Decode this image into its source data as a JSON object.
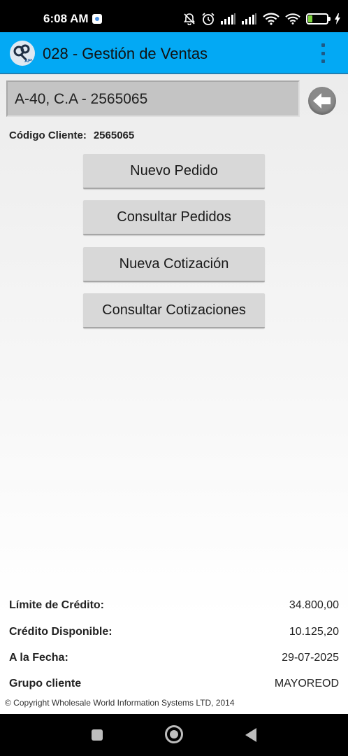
{
  "status_bar": {
    "time": "6:08 AM",
    "battery_level": "30",
    "icons": [
      "app-notification-icon",
      "bell-off-icon",
      "alarm-icon",
      "signal-icon",
      "signal-icon",
      "wifi-icon",
      "wifi-icon",
      "battery-icon",
      "charging-icon"
    ]
  },
  "app_bar": {
    "logo_text": "AFV",
    "title": "028 - Gestión de Ventas"
  },
  "client": {
    "name": "A-40, C.A - 2565065",
    "code_label": "Código Cliente:",
    "code_value": "2565065"
  },
  "actions": {
    "new_order": "Nuevo Pedido",
    "view_orders": "Consultar Pedidos",
    "new_quote": "Nueva Cotización",
    "view_quotes": "Consultar Cotizaciones"
  },
  "credit": {
    "limit_label": "Límite de Crédito:",
    "limit_value": "34.800,00",
    "available_label": "Crédito Disponible:",
    "available_value": "10.125,20",
    "date_label": "A la Fecha:",
    "date_value": "29-07-2025",
    "group_label": "Grupo cliente",
    "group_value": "MAYOREOD"
  },
  "footer": {
    "copyright": "© Copyright Wholesale World Information Systems LTD, 2014"
  },
  "colors": {
    "app_bar": "#03a9f4",
    "button_bg": "#d8d8d8",
    "client_box": "#c4c4c4",
    "battery_fill": "#7bd23b"
  }
}
